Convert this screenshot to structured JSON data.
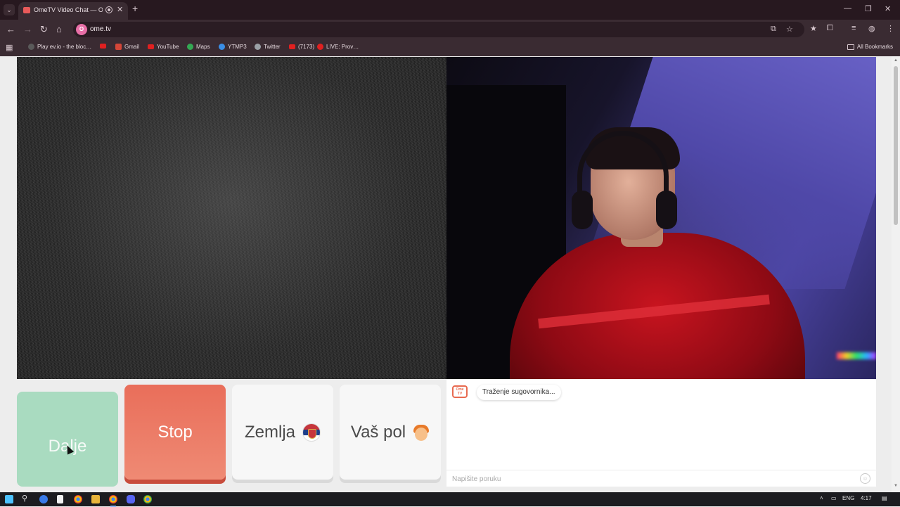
{
  "browser": {
    "tab_title": "OmeTV Video Chat — Ome",
    "tab_close": "✕",
    "new_tab": "+",
    "url": "ome.tv",
    "site_badge": "O",
    "window_controls": {
      "minimize": "—",
      "maximize": "❐",
      "close": "✕"
    }
  },
  "bookmarks": {
    "items": [
      {
        "label": "Play ev.io - the bloc…",
        "icon": "evio-icon",
        "color": "#5a5a5a"
      },
      {
        "label": "",
        "icon": "youtube-icon",
        "color": "#e02020"
      },
      {
        "label": "Gmail",
        "icon": "gmail-icon",
        "color": "#d44638"
      },
      {
        "label": "YouTube",
        "icon": "youtube-icon",
        "color": "#e02020"
      },
      {
        "label": "Maps",
        "icon": "maps-icon",
        "color": "#34a853"
      },
      {
        "label": "YTMP3",
        "icon": "ytmp3-icon",
        "color": "#3a8ee6"
      },
      {
        "label": "Twitter",
        "icon": "globe-icon",
        "color": "#9aa0a6"
      },
      {
        "label": "(7173)",
        "icon": "youtube-icon",
        "color": "#e02020"
      },
      {
        "label": "LIVE: Prov…",
        "icon": "live-icon",
        "color": "#e02020"
      }
    ],
    "all_bookmarks": "All Bookmarks"
  },
  "controls": {
    "next_label": "Dalje",
    "stop_label": "Stop",
    "country_label": "Zemlja",
    "country_flag": "serbia-flag-icon",
    "gender_label": "Vaš pol",
    "gender_icon": "boy-avatar-icon"
  },
  "chat": {
    "logo_line1": "Ome",
    "logo_line2": "TV",
    "status_message": "Traženje sugovornika...",
    "input_placeholder": "Napišite poruku",
    "input_value": ""
  },
  "taskbar": {
    "language": "ENG",
    "time": "4:17"
  },
  "colors": {
    "next_button": "#a9dbc0",
    "stop_button": "#e96e5a",
    "accent": "#e86a50"
  }
}
